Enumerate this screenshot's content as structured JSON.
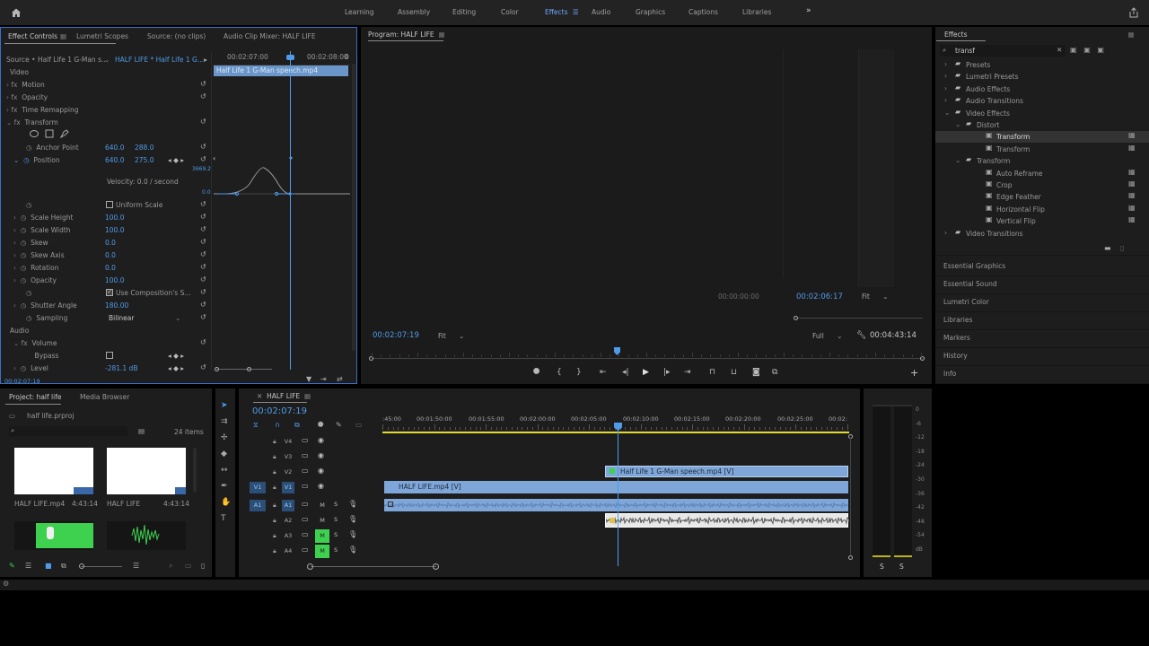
{
  "workspace": {
    "tabs": [
      "Learning",
      "Assembly",
      "Editing",
      "Color",
      "Effects",
      "Audio",
      "Graphics",
      "Captions",
      "Libraries"
    ],
    "active": "Effects",
    "more": "»"
  },
  "effect_controls": {
    "tabs": [
      "Effect Controls",
      "Lumetri Scopes",
      "Source: (no clips)",
      "Audio Clip Mixer: HALF LIFE"
    ],
    "source": "Source • Half Life 1 G-Man s...",
    "sequence": "HALF LIFE * Half Life 1 G...",
    "time_ticks": [
      "00:02:07:00",
      "00:02:08:00"
    ],
    "tick_zero": "0",
    "clip": "Half Life 1 G-Man speech.mp4",
    "section_video": "Video",
    "motion": "Motion",
    "opacity_fx": "Opacity",
    "time_remap": "Time Remapping",
    "transform": "Transform",
    "anchor_label": "Anchor Point",
    "anchor_x": "640.0",
    "anchor_y": "288.0",
    "position_label": "Position",
    "position_x": "640.0",
    "position_y": "275.0",
    "graph_max": "3669.2",
    "graph_min": "0.0",
    "velocity": "Velocity: 0.0 / second",
    "uniform_scale": "Uniform Scale",
    "scale_height_label": "Scale Height",
    "scale_height": "100.0",
    "scale_width_label": "Scale Width",
    "scale_width": "100.0",
    "skew_label": "Skew",
    "skew": "0.0",
    "skew_axis_label": "Skew Axis",
    "skew_axis": "0.0",
    "rotation_label": "Rotation",
    "rotation": "0.0",
    "opacity_label": "Opacity",
    "opacity": "100.0",
    "use_comp": "Use Composition's S...",
    "shutter_label": "Shutter Angle",
    "shutter": "180.00",
    "sampling_label": "Sampling",
    "sampling": "Bilinear",
    "section_audio": "Audio",
    "volume": "Volume",
    "bypass_label": "Bypass",
    "level_label": "Level",
    "level": "-281.1 dB",
    "footer_time": "00:02:07:19"
  },
  "program": {
    "title": "Program: HALF LIFE",
    "timecode": "00:02:07:19",
    "fit": "Fit",
    "full": "Full",
    "duration": "00:04:43:14",
    "src_in": "00:00:00:00",
    "src_time": "00:02:06:17",
    "src_fit": "Fit"
  },
  "effects": {
    "title": "Effects",
    "search": "transf",
    "items": [
      {
        "label": "Presets",
        "indent": 0,
        "folder": true
      },
      {
        "label": "Lumetri Presets",
        "indent": 0,
        "folder": true
      },
      {
        "label": "Audio Effects",
        "indent": 0,
        "folder": true
      },
      {
        "label": "Audio Transitions",
        "indent": 0,
        "folder": true
      },
      {
        "label": "Video Effects",
        "indent": 0,
        "folder": true
      },
      {
        "label": "Distort",
        "indent": 1,
        "folder": true
      },
      {
        "label": "Transform",
        "indent": 2,
        "folder": false,
        "sel": true
      },
      {
        "label": "Transform",
        "indent": 2,
        "folder": false
      },
      {
        "label": "Transform",
        "indent": 1,
        "folder": true
      },
      {
        "label": "Auto Reframe",
        "indent": 2,
        "folder": false
      },
      {
        "label": "Crop",
        "indent": 2,
        "folder": false
      },
      {
        "label": "Edge Feather",
        "indent": 2,
        "folder": false
      },
      {
        "label": "Horizontal Flip",
        "indent": 2,
        "folder": false
      },
      {
        "label": "Vertical Flip",
        "indent": 2,
        "folder": false
      },
      {
        "label": "Video Transitions",
        "indent": 0,
        "folder": true
      }
    ],
    "sections": [
      "Essential Graphics",
      "Essential Sound",
      "Lumetri Color",
      "Libraries",
      "Markers",
      "History",
      "Info"
    ]
  },
  "project": {
    "tabs": [
      "Project: half life",
      "Media Browser"
    ],
    "file": "half life.prproj",
    "count": "24 items",
    "thumbs": [
      {
        "name": "HALF LIFE.mp4",
        "dur": "4:43:14"
      },
      {
        "name": "HALF LIFE",
        "dur": "4:43:14"
      }
    ]
  },
  "timeline": {
    "title": "HALF LIFE",
    "timecode": "00:02:07:19",
    "ruler": [
      ":45:00",
      "00:01:50:00",
      "00:01:55:00",
      "00:02:00:00",
      "00:02:05:00",
      "00:02:10:00",
      "00:02:15:00",
      "00:02:20:00",
      "00:02:25:00",
      "00:02:"
    ],
    "tracks": [
      {
        "name": "V4",
        "kind": "video"
      },
      {
        "name": "V3",
        "kind": "video"
      },
      {
        "name": "V2",
        "kind": "video"
      },
      {
        "name": "V1",
        "kind": "video",
        "src": "V1"
      },
      {
        "name": "A1",
        "kind": "audio",
        "src": "A1"
      },
      {
        "name": "A2",
        "kind": "audio"
      },
      {
        "name": "A3",
        "kind": "audio",
        "m_on": true
      },
      {
        "name": "A4",
        "kind": "audio",
        "m_on": true
      }
    ],
    "m": "M",
    "s": "S",
    "clip_v2": "Half Life 1 G-Man speech.mp4 [V]",
    "clip_v1": "HALF LIFE.mp4 [V]",
    "meter_ticks": [
      "0",
      "-6",
      "-12",
      "-18",
      "-24",
      "-30",
      "-36",
      "-42",
      "-48",
      "-54",
      "dB"
    ],
    "meter_s": [
      "S",
      "S"
    ]
  },
  "colors": {
    "accent": "#4f9be8",
    "effects_tab": "#6ea8ff",
    "green": "#3ed14f"
  }
}
